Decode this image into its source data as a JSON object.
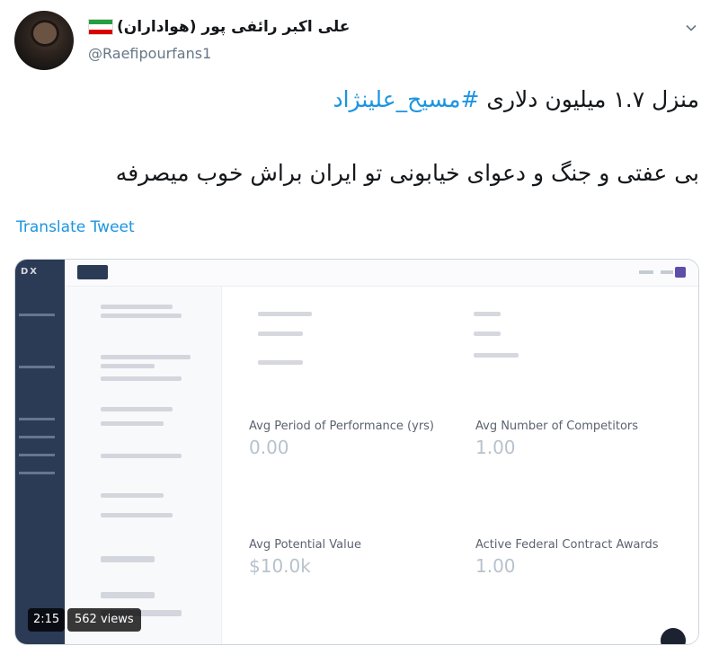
{
  "tweet": {
    "display_name": "علی اکبر رائفی پور (هواداران)",
    "handle": "@Raefipourfans1",
    "line1_text": "منزل ۱.۷ میلیون دلاری ",
    "line1_hashtag": "#مسیح_علینژاد",
    "line2_text": "بی عفتی و جنگ و دعوای خیابونی تو ایران براش خوب میصرفه",
    "translate_label": "Translate Tweet"
  },
  "video": {
    "duration": "2:15",
    "views": "562 views",
    "metrics": [
      {
        "label": "Avg Period of Performance (yrs)",
        "value": "0.00"
      },
      {
        "label": "Avg Number of Competitors",
        "value": "1.00"
      },
      {
        "label": "Avg Potential Value",
        "value": "$10.0k"
      },
      {
        "label": "Active Federal Contract Awards",
        "value": "1.00"
      }
    ]
  },
  "colors": {
    "link": "#1b95e0",
    "secondary": "#657786",
    "sidebar": "#2b3a55"
  }
}
